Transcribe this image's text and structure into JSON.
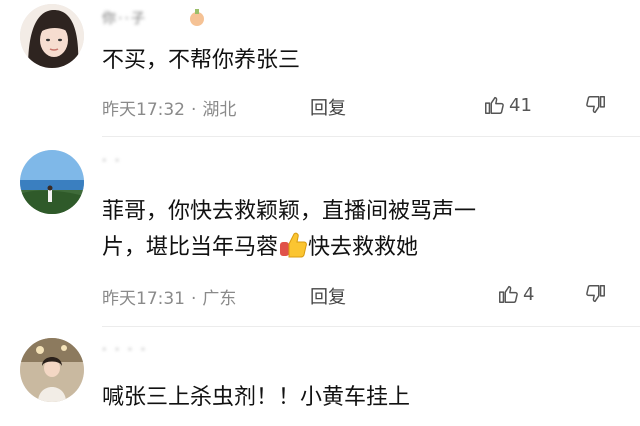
{
  "comments": [
    {
      "username": "你··子",
      "text_lines": [
        "不买，不帮你养张三"
      ],
      "time": "昨天17:32",
      "location": "湖北",
      "reply_label": "回复",
      "likes": "41"
    },
    {
      "username": "· ·",
      "text_lines": [
        "菲哥，你快去救颖颖，直播间被骂声一",
        "片，堪比当年马蓉",
        "快去救救她"
      ],
      "emoji": "thumbs-up-emoji",
      "time": "昨天17:31",
      "location": "广东",
      "reply_label": "回复",
      "likes": "4"
    },
    {
      "username": "· · · ·",
      "text_lines": [
        "喊张三上杀虫剂！！小黄车挂上"
      ]
    }
  ],
  "icons": {
    "like": "thumbs-up-outline-icon",
    "dislike": "thumbs-down-outline-icon"
  }
}
